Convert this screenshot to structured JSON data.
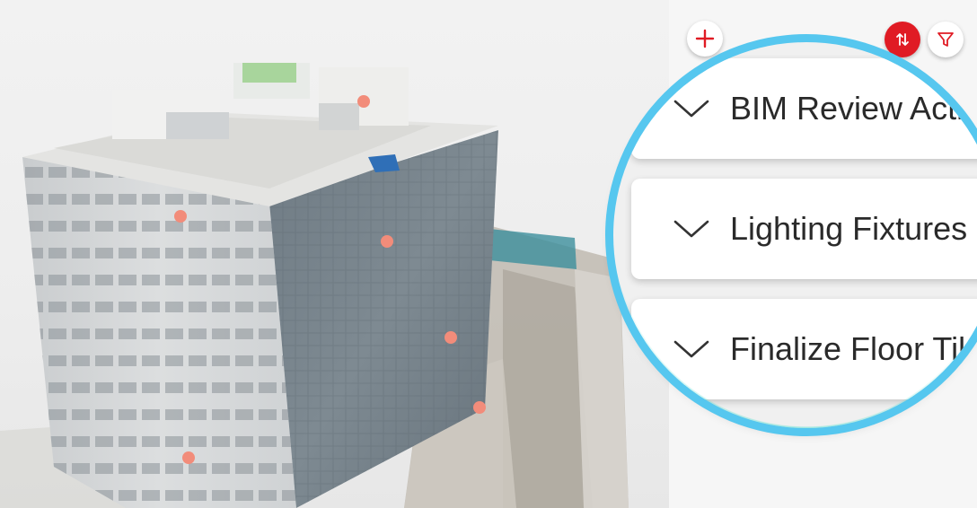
{
  "viewer": {
    "markers": [
      {
        "name": "issue-marker-roof"
      },
      {
        "name": "issue-marker-facade-left"
      },
      {
        "name": "issue-marker-facade-right-upper"
      },
      {
        "name": "issue-marker-facade-right-middle"
      },
      {
        "name": "issue-marker-facade-right-lower"
      },
      {
        "name": "issue-marker-facade-left-lower"
      }
    ],
    "marker_color": "#f28c7a"
  },
  "toolbar": {
    "add_icon": "plus-icon",
    "sort_icon": "sort-arrows-icon",
    "filter_icon": "funnel-icon",
    "accent_color": "#e01b24"
  },
  "task_list": {
    "items": [
      {
        "label": "BIM Review Activ",
        "icon": "chevron-down-icon"
      },
      {
        "label": "Lighting Fixtures",
        "icon": "chevron-down-icon"
      },
      {
        "label": "Finalize Floor Tile",
        "icon": "chevron-down-icon"
      }
    ],
    "more_icon": "kebab-menu-icon"
  },
  "magnifier": {
    "ring_color": "#56c7ef"
  }
}
